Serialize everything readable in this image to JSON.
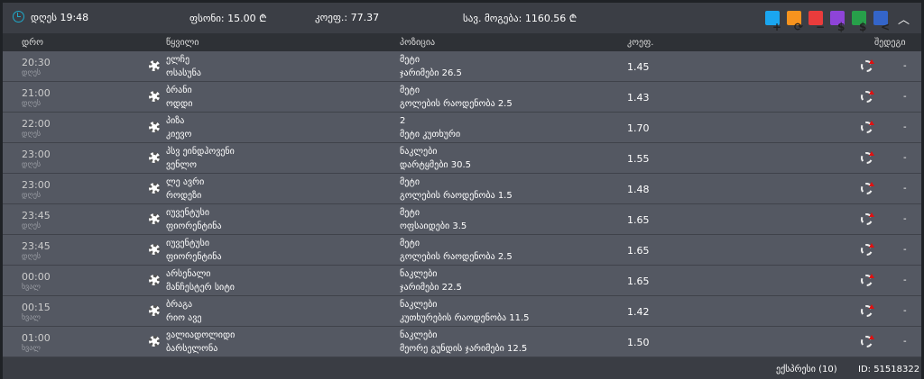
{
  "header": {
    "time": "დღეს 19:48",
    "stake": "ფსონი: 15.00 ₾",
    "odds": "კოეფ.: 77.37",
    "payout": "სავ. მოგება: 1160.56 ₾"
  },
  "toolbar": [
    {
      "name": "add",
      "glyph": "+",
      "color": "#1aa6f0"
    },
    {
      "name": "refresh",
      "glyph": "⟳",
      "color": "#f7931e"
    },
    {
      "name": "remove",
      "glyph": "−",
      "color": "#ea3c3c"
    },
    {
      "name": "auto-cashout",
      "glyph": "$",
      "color": "#8e44d8"
    },
    {
      "name": "cashout",
      "glyph": "$",
      "color": "#27a04a"
    },
    {
      "name": "share",
      "glyph": "<",
      "color": "#3465c9"
    }
  ],
  "columns": {
    "time": "დრო",
    "pair": "წყვილი",
    "position": "პოზიცია",
    "odds": "კოეფ.",
    "result": "შედეგი"
  },
  "rows": [
    {
      "time": "20:30",
      "day": "დღეს",
      "home": "ელჩე",
      "away": "ოსასუნა",
      "pos1": "მეტი",
      "pos2": "ჯარიმები 26.5",
      "odds": "1.45",
      "result": "-"
    },
    {
      "time": "21:00",
      "day": "დღეს",
      "home": "ბრანი",
      "away": "ოდდი",
      "pos1": "მეტი",
      "pos2": "გოლების რაოდენობა 2.5",
      "odds": "1.43",
      "result": "-"
    },
    {
      "time": "22:00",
      "day": "დღეს",
      "home": "პიზა",
      "away": "კიევო",
      "pos1": "2",
      "pos2": "მეტი კუთხური",
      "odds": "1.70",
      "result": "-"
    },
    {
      "time": "23:00",
      "day": "დღეს",
      "home": "პსვ ეინდჰოვენი",
      "away": "ვენლო",
      "pos1": "ნაკლები",
      "pos2": "დარტყმები 30.5",
      "odds": "1.55",
      "result": "-"
    },
    {
      "time": "23:00",
      "day": "დღეს",
      "home": "ლე ავრი",
      "away": "როდეზი",
      "pos1": "მეტი",
      "pos2": "გოლების რაოდენობა 1.5",
      "odds": "1.48",
      "result": "-"
    },
    {
      "time": "23:45",
      "day": "დღეს",
      "home": "იუვენტუსი",
      "away": "ფიორენტინა",
      "pos1": "მეტი",
      "pos2": "ოფსაიდები 3.5",
      "odds": "1.65",
      "result": "-"
    },
    {
      "time": "23:45",
      "day": "დღეს",
      "home": "იუვენტუსი",
      "away": "ფიორენტინა",
      "pos1": "მეტი",
      "pos2": "გოლების რაოდენობა 2.5",
      "odds": "1.65",
      "result": "-"
    },
    {
      "time": "00:00",
      "day": "ხვალ",
      "home": "არსენალი",
      "away": "მანჩესტერ სიტი",
      "pos1": "ნაკლები",
      "pos2": "ჯარიმები 22.5",
      "odds": "1.65",
      "result": "-"
    },
    {
      "time": "00:15",
      "day": "ხვალ",
      "home": "ბრაგა",
      "away": "რიო ავე",
      "pos1": "ნაკლები",
      "pos2": "კუთხურების რაოდენობა 11.5",
      "odds": "1.42",
      "result": "-"
    },
    {
      "time": "01:00",
      "day": "ხვალ",
      "home": "ვალიადოლიდი",
      "away": "ბარსელონა",
      "pos1": "ნაკლები",
      "pos2": "მეორე გუნდის ჯარიმები 12.5",
      "odds": "1.50",
      "result": "-"
    }
  ],
  "footer": {
    "type": "ექსპრესი (10)",
    "id": "ID: 51518322"
  }
}
